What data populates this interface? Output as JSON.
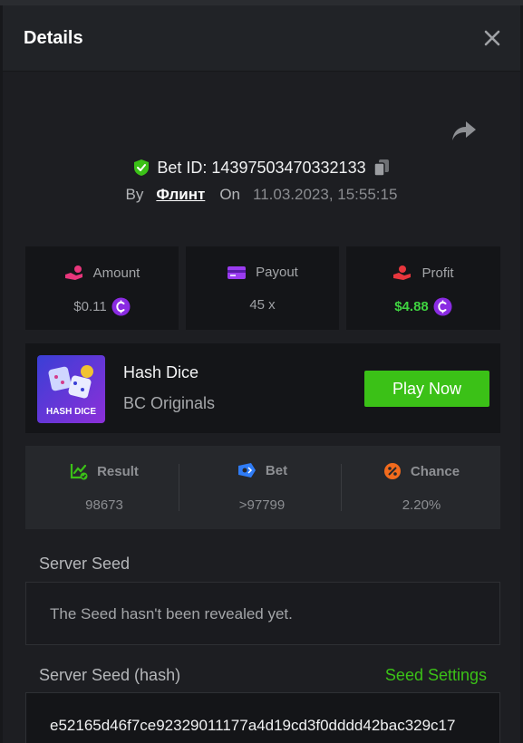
{
  "header": {
    "title": "Details"
  },
  "bet": {
    "id_text": "Bet ID: 14397503470332133",
    "by_label": "By",
    "user": "Флинт",
    "on_label": "On",
    "date": "11.03.2023, 15:55:15"
  },
  "stats": {
    "amount": {
      "label": "Amount",
      "value": "$0.11",
      "icon": "hand-coins-icon"
    },
    "payout": {
      "label": "Payout",
      "value": "45 x",
      "icon": "card-icon"
    },
    "profit": {
      "label": "Profit",
      "value": "$4.88",
      "icon": "hand-profit-icon"
    }
  },
  "game": {
    "name": "Hash Dice",
    "provider": "BC Originals",
    "thumb_text": "HASH DICE",
    "play_label": "Play Now"
  },
  "results": {
    "result": {
      "label": "Result",
      "value": "98673"
    },
    "bet": {
      "label": "Bet",
      "value": ">97799"
    },
    "chance": {
      "label": "Chance",
      "value": "2.20%"
    }
  },
  "server_seed": {
    "label": "Server Seed",
    "value": "The Seed hasn't been revealed yet."
  },
  "server_seed_hash": {
    "label": "Server Seed (hash)",
    "settings_label": "Seed Settings",
    "value": "e52165d46f7ce92329011177a4d19cd3f0dddd42bac329c17"
  },
  "colors": {
    "accent_green": "#3bc117",
    "profit_green": "#3fd340",
    "coin_purple": "#8a2be2",
    "amount_pink": "#e8367b",
    "chance_orange": "#f26b1d",
    "bet_blue": "#2f7cf6"
  }
}
